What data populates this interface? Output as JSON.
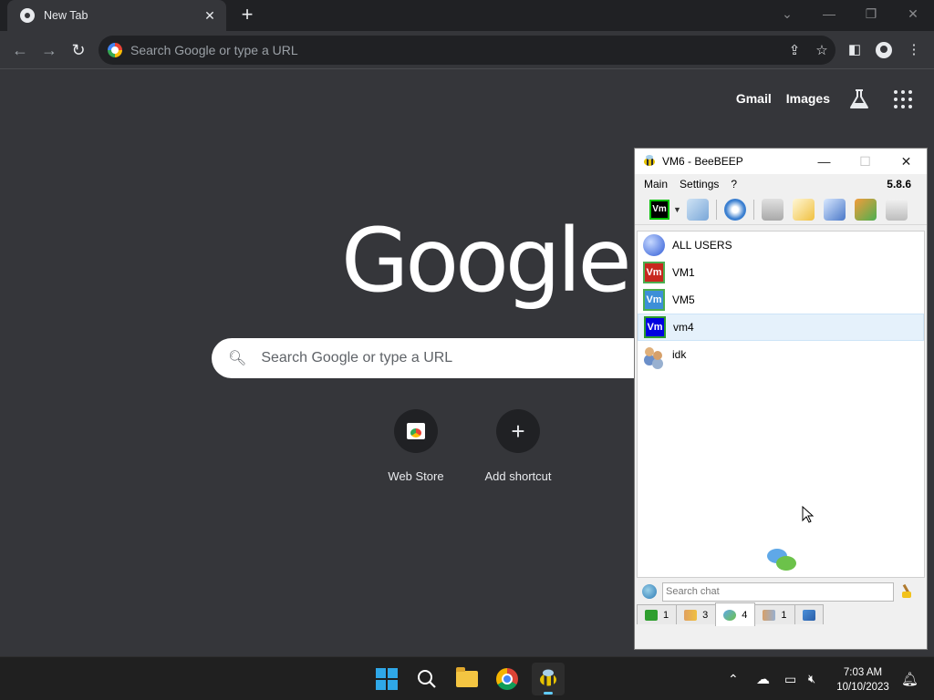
{
  "browser": {
    "tab_title": "New Tab",
    "tab_close": "✕",
    "new_tab": "+",
    "omnibox_placeholder": "Search Google or type a URL"
  },
  "ntp": {
    "links": [
      "Gmail",
      "Images"
    ],
    "logo": "Google",
    "search_placeholder": "Search Google or type a URL",
    "shortcuts": [
      {
        "label": "Web Store",
        "icon": "web-store-icon"
      },
      {
        "label": "Add shortcut",
        "icon": "plus-icon",
        "glyph": "+"
      }
    ]
  },
  "beebeep": {
    "title": "VM6 - BeeBEEP",
    "menu": [
      "Main",
      "Settings",
      "?"
    ],
    "version": "5.8.6",
    "user_badge": "Vm",
    "users": [
      {
        "name": "ALL USERS",
        "avatar": "globe",
        "badge": ""
      },
      {
        "name": "VM1",
        "avatar": "red",
        "badge": "Vm"
      },
      {
        "name": "VM5",
        "avatar": "lightblue",
        "badge": "Vm"
      },
      {
        "name": "vm4",
        "avatar": "blue",
        "badge": "Vm",
        "selected": true
      },
      {
        "name": "idk",
        "avatar": "group",
        "badge": ""
      }
    ],
    "search_placeholder": "Search chat",
    "tabs": [
      {
        "count": "1",
        "icon": "computer-icon"
      },
      {
        "count": "3",
        "icon": "users-icon"
      },
      {
        "count": "4",
        "icon": "chat-icon",
        "active": true
      },
      {
        "count": "1",
        "icon": "group-icon"
      },
      {
        "count": "",
        "icon": "file-share-icon"
      }
    ]
  },
  "taskbar": {
    "time": "7:03 AM",
    "date": "10/10/2023"
  },
  "colors": {
    "chrome_bg": "#35363a",
    "tabstrip": "#202124",
    "taskbar": "#202020",
    "accent": "#60cdff"
  }
}
